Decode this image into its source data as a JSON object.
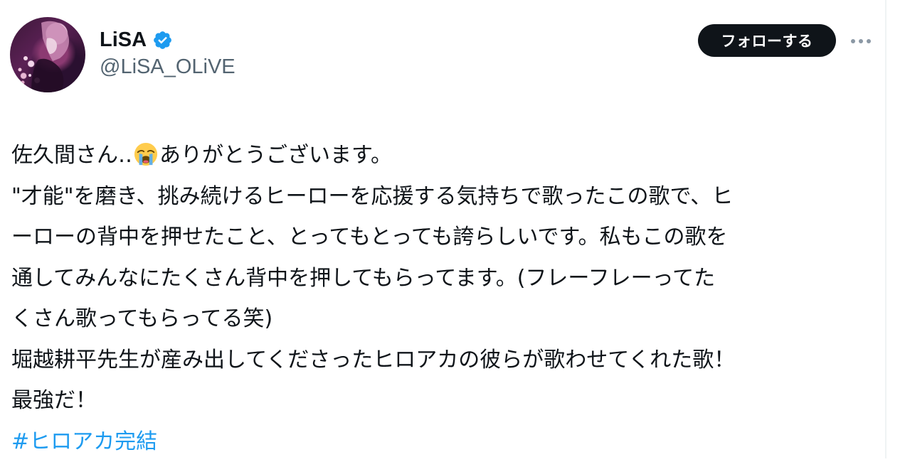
{
  "author": {
    "display_name": "LiSA",
    "handle": "@LiSA_OLiVE",
    "verified_icon": "verified-badge-icon",
    "avatar_icon": "profile-avatar"
  },
  "actions": {
    "follow_label": "フォローする",
    "more_icon": "more-options-icon"
  },
  "tweet": {
    "line1_before_emoji": "佐久間さん‥",
    "emoji_icon": "loudly-crying-face-emoji",
    "line1_after_emoji": "ありがとうございます。",
    "lines": [
      "\"才能\"を磨き、挑み続けるヒーローを応援する気持ちで歌ったこの歌で、ヒ",
      "ーローの背中を押せたこと、とってもとっても誇らしいです。私もこの歌を",
      "通してみんなにたくさん背中を押してもらってます。(フレーフレーってた",
      "くさん歌ってもらってる笑)",
      "堀越耕平先生が産み出してくださったヒロアカの彼らが歌わせてくれた歌！",
      "最強だ！"
    ],
    "hashtag": "#ヒロアカ完結"
  },
  "colors": {
    "text": "#0f1419",
    "secondary_text": "#536471",
    "link": "#1d9bf0",
    "follow_button_bg": "#0f1419",
    "verified": "#1d9bf0",
    "emoji_face": "#ffcc4d"
  }
}
